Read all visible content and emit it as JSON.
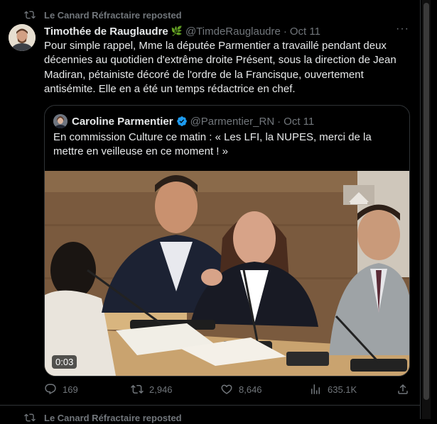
{
  "repost": {
    "text": "Le Canard Réfractaire reposted"
  },
  "tweet": {
    "author_name": "Timothée de Rauglaudre",
    "leaf_emoji": "🌿",
    "handle": "@TimdeRauglaudre",
    "date": "Oct 11",
    "text": "Pour simple rappel, Mme la députée Parmentier a travaillé pendant deux décennies au quotidien d'extrême droite Présent, sous la direction de Jean Madiran, pétainiste décoré de l'ordre de la Francisque, ouvertement antisémite. Elle en a été un temps rédactrice en chef."
  },
  "quote": {
    "author_name": "Caroline Parmentier",
    "handle": "@Parmentier_RN",
    "date": "Oct 11",
    "text": "En commission Culture ce matin : « Les LFI, la NUPES, merci de la mettre en veilleuse en ce moment ! »",
    "video_time": "0:03"
  },
  "actions": {
    "replies": "169",
    "reposts": "2,946",
    "likes": "8,646",
    "views": "635.1K"
  },
  "next": {
    "repost_text": "Le Canard Réfractaire reposted"
  },
  "colors": {
    "background": "#000000",
    "muted": "#71767b",
    "text": "#e7e9ea",
    "border": "#2f3336",
    "verified": "#1d9bf0"
  },
  "icons": [
    "repost-icon",
    "more-icon",
    "verified-badge-icon",
    "reply-icon",
    "like-icon",
    "views-icon",
    "share-icon"
  ]
}
